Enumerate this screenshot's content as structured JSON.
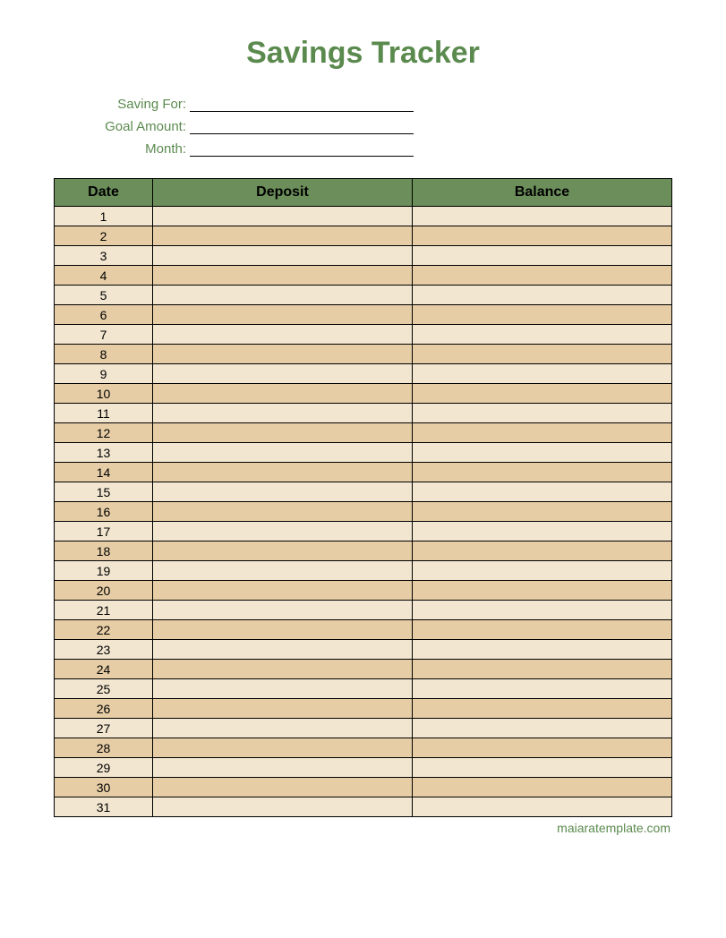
{
  "title": "Savings Tracker",
  "form": {
    "saving_for_label": "Saving For:",
    "goal_amount_label": "Goal Amount:",
    "month_label": "Month:",
    "saving_for_value": "",
    "goal_amount_value": "",
    "month_value": ""
  },
  "table": {
    "headers": {
      "date": "Date",
      "deposit": "Deposit",
      "balance": "Balance"
    },
    "rows": [
      {
        "date": "1",
        "deposit": "",
        "balance": ""
      },
      {
        "date": "2",
        "deposit": "",
        "balance": ""
      },
      {
        "date": "3",
        "deposit": "",
        "balance": ""
      },
      {
        "date": "4",
        "deposit": "",
        "balance": ""
      },
      {
        "date": "5",
        "deposit": "",
        "balance": ""
      },
      {
        "date": "6",
        "deposit": "",
        "balance": ""
      },
      {
        "date": "7",
        "deposit": "",
        "balance": ""
      },
      {
        "date": "8",
        "deposit": "",
        "balance": ""
      },
      {
        "date": "9",
        "deposit": "",
        "balance": ""
      },
      {
        "date": "10",
        "deposit": "",
        "balance": ""
      },
      {
        "date": "11",
        "deposit": "",
        "balance": ""
      },
      {
        "date": "12",
        "deposit": "",
        "balance": ""
      },
      {
        "date": "13",
        "deposit": "",
        "balance": ""
      },
      {
        "date": "14",
        "deposit": "",
        "balance": ""
      },
      {
        "date": "15",
        "deposit": "",
        "balance": ""
      },
      {
        "date": "16",
        "deposit": "",
        "balance": ""
      },
      {
        "date": "17",
        "deposit": "",
        "balance": ""
      },
      {
        "date": "18",
        "deposit": "",
        "balance": ""
      },
      {
        "date": "19",
        "deposit": "",
        "balance": ""
      },
      {
        "date": "20",
        "deposit": "",
        "balance": ""
      },
      {
        "date": "21",
        "deposit": "",
        "balance": ""
      },
      {
        "date": "22",
        "deposit": "",
        "balance": ""
      },
      {
        "date": "23",
        "deposit": "",
        "balance": ""
      },
      {
        "date": "24",
        "deposit": "",
        "balance": ""
      },
      {
        "date": "25",
        "deposit": "",
        "balance": ""
      },
      {
        "date": "26",
        "deposit": "",
        "balance": ""
      },
      {
        "date": "27",
        "deposit": "",
        "balance": ""
      },
      {
        "date": "28",
        "deposit": "",
        "balance": ""
      },
      {
        "date": "29",
        "deposit": "",
        "balance": ""
      },
      {
        "date": "30",
        "deposit": "",
        "balance": ""
      },
      {
        "date": "31",
        "deposit": "",
        "balance": ""
      }
    ]
  },
  "footer": "maiaratemplate.com"
}
